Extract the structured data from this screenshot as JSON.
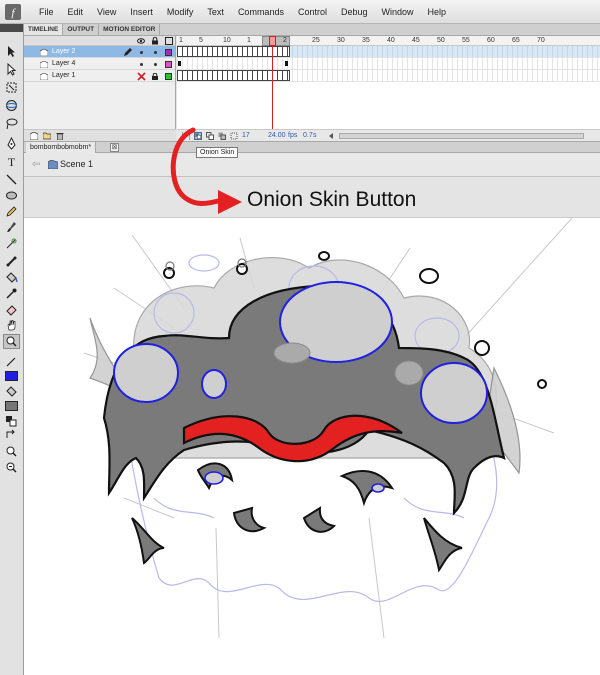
{
  "menu": [
    "File",
    "Edit",
    "View",
    "Insert",
    "Modify",
    "Text",
    "Commands",
    "Control",
    "Debug",
    "Window",
    "Help"
  ],
  "panel_tabs": [
    "TIMELINE",
    "OUTPUT",
    "MOTION EDITOR"
  ],
  "layers": [
    {
      "name": "Layer 2",
      "color": "#9c2fc2",
      "selected": true
    },
    {
      "name": "Layer 4",
      "color": "#e050d0",
      "selected": false
    },
    {
      "name": "Layer 1",
      "color": "#2ec22e",
      "selected": false
    }
  ],
  "frame_ruler_ticks": [
    "1",
    "5",
    "10",
    "1",
    "2",
    "25",
    "30",
    "35",
    "40",
    "45",
    "50",
    "55",
    "60",
    "65",
    "70"
  ],
  "status": {
    "current_frame": "17",
    "frame_rate": "24.00",
    "fps_unit": "fps",
    "elapsed": "0.7",
    "seconds_unit": "s"
  },
  "document": {
    "tab_title": "bombombobmobm*",
    "close_glyph": "⊠",
    "scene": "Scene 1"
  },
  "tooltip": "Onion Skin",
  "annotation": "Onion Skin Button",
  "colors": {
    "accent_red": "#e32121",
    "selected_layer": "#8fb9e5",
    "panel_bg": "#e6e6e6",
    "stroke_color": "#2020e0",
    "fill_color": "#777777"
  }
}
